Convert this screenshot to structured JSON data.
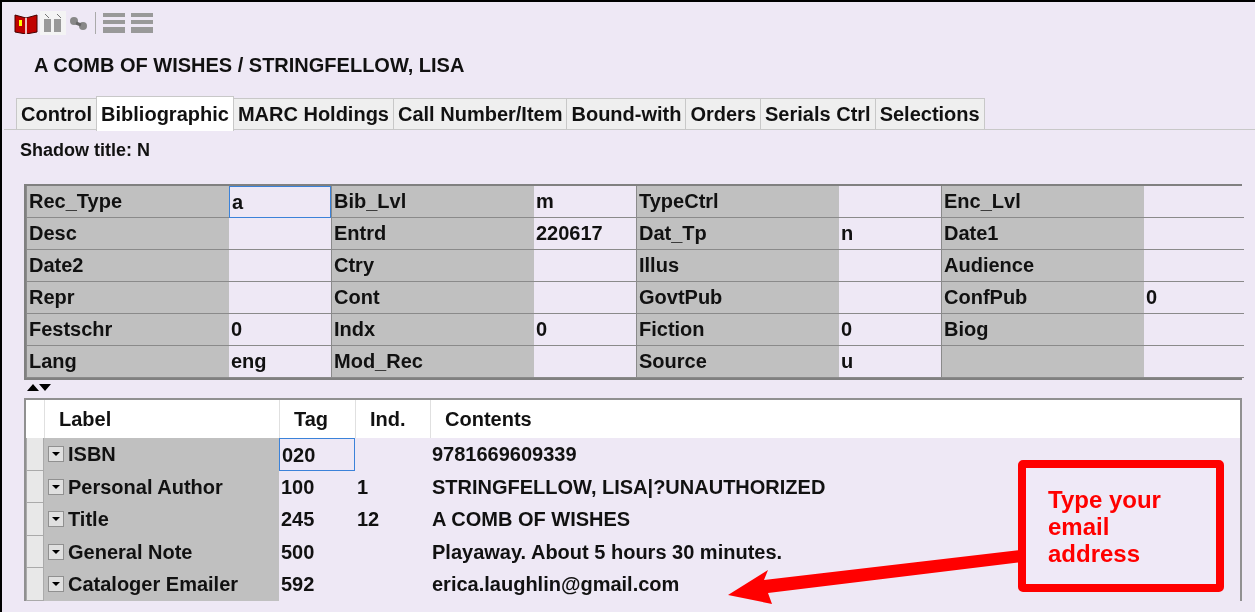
{
  "record_title": "A COMB OF WISHES / STRINGFELLOW, LISA",
  "tabs": [
    {
      "label": "Control",
      "selected": false
    },
    {
      "label": "Bibliographic",
      "selected": true
    },
    {
      "label": "MARC Holdings",
      "selected": false
    },
    {
      "label": "Call Number/Item",
      "selected": false
    },
    {
      "label": "Bound-with",
      "selected": false
    },
    {
      "label": "Orders",
      "selected": false
    },
    {
      "label": "Serials Ctrl",
      "selected": false
    },
    {
      "label": "Selections",
      "selected": false
    }
  ],
  "shadow_title": "Shadow title: N",
  "fixed_fields": [
    [
      {
        "label": "Rec_Type",
        "value": "a",
        "focused": true
      },
      {
        "label": "Bib_Lvl",
        "value": "m",
        "focused": false
      },
      {
        "label": "TypeCtrl",
        "focused": false
      },
      {
        "label": "Enc_Lvl",
        "focused": false
      }
    ],
    [
      {
        "label": "Desc",
        "focused": false
      },
      {
        "label": "Entrd",
        "value": "220617",
        "focused": false
      },
      {
        "label": "Dat_Tp",
        "value": "n",
        "focused": false
      },
      {
        "label": "Date1",
        "focused": false
      }
    ],
    [
      {
        "label": "Date2",
        "focused": false
      },
      {
        "label": "Ctry",
        "focused": false
      },
      {
        "label": "Illus",
        "focused": false
      },
      {
        "label": "Audience",
        "focused": false
      }
    ],
    [
      {
        "label": "Repr",
        "focused": false
      },
      {
        "label": "Cont",
        "focused": false
      },
      {
        "label": "GovtPub",
        "focused": false
      },
      {
        "label": "ConfPub",
        "value": "0",
        "focused": false
      }
    ],
    [
      {
        "label": "Festschr",
        "value": "0",
        "focused": false
      },
      {
        "label": "Indx",
        "value": "0",
        "focused": false
      },
      {
        "label": "Fiction",
        "value": "0",
        "focused": false
      },
      {
        "label": "Biog",
        "focused": false
      }
    ],
    [
      {
        "label": "Lang",
        "value": "eng",
        "focused": false
      },
      {
        "label": "Mod_Rec",
        "focused": false
      },
      {
        "label": "Source",
        "value": "u",
        "focused": false
      },
      {
        "focused": false
      }
    ]
  ],
  "variable_fields": {
    "columns": [
      "Label",
      "Tag",
      "Ind.",
      "Contents"
    ],
    "rows": [
      {
        "label": "ISBN",
        "tag": "020",
        "contents": "9781669609339",
        "tag_focused": true
      },
      {
        "label": "Personal Author",
        "tag": "100",
        "ind": "1",
        "contents": "STRINGFELLOW, LISA|?UNAUTHORIZED",
        "tag_focused": false
      },
      {
        "label": "Title",
        "tag": "245",
        "ind": "12",
        "contents": "A COMB OF WISHES",
        "tag_focused": false
      },
      {
        "label": "General Note",
        "tag": "500",
        "contents": "Playaway. About 5 hours 30 minutes.",
        "tag_focused": false
      },
      {
        "label": "Cataloger Emailer",
        "tag": "592",
        "contents": "erica.laughlin@gmail.com",
        "tag_focused": false
      }
    ]
  },
  "callout": {
    "text": "Type your email address"
  }
}
